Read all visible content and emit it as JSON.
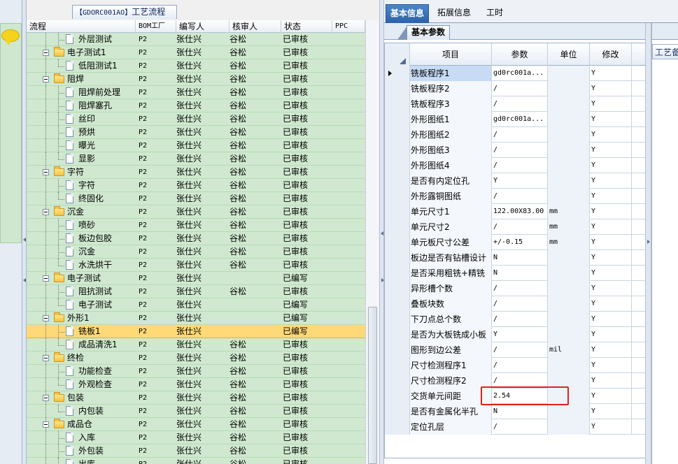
{
  "title_tab": {
    "code": "【GDORC001AO】",
    "label": "工艺流程"
  },
  "tree_grid": {
    "columns": [
      "流程",
      "BOM工厂",
      "编写人",
      "核审人",
      "状态",
      "PPC"
    ],
    "rows": [
      {
        "name": "外层测试",
        "bom": "P2",
        "writer": "张仕兴",
        "reviewer": "谷松",
        "status": "已审核",
        "level": 2,
        "folder": false,
        "last": false
      },
      {
        "name": "电子测试1",
        "bom": "P2",
        "writer": "张仕兴",
        "reviewer": "谷松",
        "status": "已审核",
        "level": 1,
        "folder": true,
        "last": false
      },
      {
        "name": "低阻测试1",
        "bom": "P2",
        "writer": "张仕兴",
        "reviewer": "谷松",
        "status": "已审核",
        "level": 2,
        "folder": false,
        "last": true
      },
      {
        "name": "阻焊",
        "bom": "P2",
        "writer": "张仕兴",
        "reviewer": "谷松",
        "status": "已审核",
        "level": 1,
        "folder": true,
        "last": false
      },
      {
        "name": "阻焊前处理",
        "bom": "P2",
        "writer": "张仕兴",
        "reviewer": "谷松",
        "status": "已审核",
        "level": 2,
        "folder": false,
        "last": false
      },
      {
        "name": "阻焊塞孔",
        "bom": "P2",
        "writer": "张仕兴",
        "reviewer": "谷松",
        "status": "已审核",
        "level": 2,
        "folder": false,
        "last": false
      },
      {
        "name": "丝印",
        "bom": "P2",
        "writer": "张仕兴",
        "reviewer": "谷松",
        "status": "已审核",
        "level": 2,
        "folder": false,
        "last": false
      },
      {
        "name": "预烘",
        "bom": "P2",
        "writer": "张仕兴",
        "reviewer": "谷松",
        "status": "已审核",
        "level": 2,
        "folder": false,
        "last": false
      },
      {
        "name": "曝光",
        "bom": "P2",
        "writer": "张仕兴",
        "reviewer": "谷松",
        "status": "已审核",
        "level": 2,
        "folder": false,
        "last": false
      },
      {
        "name": "显影",
        "bom": "P2",
        "writer": "张仕兴",
        "reviewer": "谷松",
        "status": "已审核",
        "level": 2,
        "folder": false,
        "last": true
      },
      {
        "name": "字符",
        "bom": "P2",
        "writer": "张仕兴",
        "reviewer": "谷松",
        "status": "已审核",
        "level": 1,
        "folder": true,
        "last": false
      },
      {
        "name": "字符",
        "bom": "P2",
        "writer": "张仕兴",
        "reviewer": "谷松",
        "status": "已审核",
        "level": 2,
        "folder": false,
        "last": false
      },
      {
        "name": "终固化",
        "bom": "P2",
        "writer": "张仕兴",
        "reviewer": "谷松",
        "status": "已审核",
        "level": 2,
        "folder": false,
        "last": true
      },
      {
        "name": "沉金",
        "bom": "P2",
        "writer": "张仕兴",
        "reviewer": "谷松",
        "status": "已审核",
        "level": 1,
        "folder": true,
        "last": false
      },
      {
        "name": "喷砂",
        "bom": "P2",
        "writer": "张仕兴",
        "reviewer": "谷松",
        "status": "已审核",
        "level": 2,
        "folder": false,
        "last": false
      },
      {
        "name": "板边包胶",
        "bom": "P2",
        "writer": "张仕兴",
        "reviewer": "谷松",
        "status": "已审核",
        "level": 2,
        "folder": false,
        "last": false
      },
      {
        "name": "沉金",
        "bom": "P2",
        "writer": "张仕兴",
        "reviewer": "谷松",
        "status": "已审核",
        "level": 2,
        "folder": false,
        "last": false
      },
      {
        "name": "水洗烘干",
        "bom": "P2",
        "writer": "张仕兴",
        "reviewer": "谷松",
        "status": "已审核",
        "level": 2,
        "folder": false,
        "last": true
      },
      {
        "name": "电子测试",
        "bom": "P2",
        "writer": "张仕兴",
        "reviewer": "",
        "status": "已编写",
        "level": 1,
        "folder": true,
        "last": false
      },
      {
        "name": "阻抗测试",
        "bom": "P2",
        "writer": "张仕兴",
        "reviewer": "谷松",
        "status": "已审核",
        "level": 2,
        "folder": false,
        "last": false
      },
      {
        "name": "电子测试",
        "bom": "P2",
        "writer": "张仕兴",
        "reviewer": "",
        "status": "已编写",
        "level": 2,
        "folder": false,
        "last": true
      },
      {
        "name": "外形1",
        "bom": "P2",
        "writer": "张仕兴",
        "reviewer": "",
        "status": "已编写",
        "level": 1,
        "folder": true,
        "last": false
      },
      {
        "name": "铣板1",
        "bom": "P2",
        "writer": "张仕兴",
        "reviewer": "",
        "status": "已编写",
        "level": 2,
        "folder": false,
        "last": false,
        "selected": true
      },
      {
        "name": "成品清洗1",
        "bom": "P2",
        "writer": "张仕兴",
        "reviewer": "谷松",
        "status": "已审核",
        "level": 2,
        "folder": false,
        "last": true
      },
      {
        "name": "终检",
        "bom": "P2",
        "writer": "张仕兴",
        "reviewer": "谷松",
        "status": "已审核",
        "level": 1,
        "folder": true,
        "last": false
      },
      {
        "name": "功能检查",
        "bom": "P2",
        "writer": "张仕兴",
        "reviewer": "谷松",
        "status": "已审核",
        "level": 2,
        "folder": false,
        "last": false
      },
      {
        "name": "外观检查",
        "bom": "P2",
        "writer": "张仕兴",
        "reviewer": "谷松",
        "status": "已审核",
        "level": 2,
        "folder": false,
        "last": true
      },
      {
        "name": "包装",
        "bom": "P2",
        "writer": "张仕兴",
        "reviewer": "谷松",
        "status": "已审核",
        "level": 1,
        "folder": true,
        "last": false
      },
      {
        "name": "内包装",
        "bom": "P2",
        "writer": "张仕兴",
        "reviewer": "谷松",
        "status": "已审核",
        "level": 2,
        "folder": false,
        "last": true
      },
      {
        "name": "成品仓",
        "bom": "P2",
        "writer": "张仕兴",
        "reviewer": "谷松",
        "status": "已审核",
        "level": 1,
        "folder": true,
        "last": false
      },
      {
        "name": "入库",
        "bom": "P2",
        "writer": "张仕兴",
        "reviewer": "谷松",
        "status": "已审核",
        "level": 2,
        "folder": false,
        "last": false
      },
      {
        "name": "外包装",
        "bom": "P2",
        "writer": "张仕兴",
        "reviewer": "谷松",
        "status": "已审核",
        "level": 2,
        "folder": false,
        "last": false
      },
      {
        "name": "出库",
        "bom": "P2",
        "writer": "张仕兴",
        "reviewer": "谷松",
        "status": "已审核",
        "level": 2,
        "folder": false,
        "last": true
      }
    ]
  },
  "right_tabs": [
    "基本信息",
    "拓展信息",
    "工时"
  ],
  "sub_tab": "基本参数",
  "props": {
    "columns": [
      "项目",
      "参数",
      "单位",
      "修改"
    ],
    "rows": [
      {
        "name": "铣板程序1",
        "value": "gd0rc001a...",
        "unit": "",
        "mod": "Y",
        "current": true
      },
      {
        "name": "铣板程序2",
        "value": "/",
        "unit": "",
        "mod": "Y"
      },
      {
        "name": "铣板程序3",
        "value": "/",
        "unit": "",
        "mod": "Y"
      },
      {
        "name": "外形图纸1",
        "value": "gd0rc001a...",
        "unit": "",
        "mod": "Y"
      },
      {
        "name": "外形图纸2",
        "value": "/",
        "unit": "",
        "mod": "Y"
      },
      {
        "name": "外形图纸3",
        "value": "/",
        "unit": "",
        "mod": "Y"
      },
      {
        "name": "外形图纸4",
        "value": "/",
        "unit": "",
        "mod": "Y"
      },
      {
        "name": "是否有内定位孔",
        "value": "Y",
        "unit": "",
        "mod": "Y"
      },
      {
        "name": "外形露铜图纸",
        "value": "/",
        "unit": "",
        "mod": "Y"
      },
      {
        "name": "单元尺寸1",
        "value": "122.00X83.00",
        "unit": "mm",
        "mod": "Y"
      },
      {
        "name": "单元尺寸2",
        "value": "/",
        "unit": "mm",
        "mod": "Y"
      },
      {
        "name": "单元板尺寸公差",
        "value": "+/-0.15",
        "unit": "mm",
        "mod": "Y"
      },
      {
        "name": "板边是否有钻槽设计",
        "value": "N",
        "unit": "",
        "mod": "Y"
      },
      {
        "name": "是否采用粗铣+精铣",
        "value": "N",
        "unit": "",
        "mod": "Y"
      },
      {
        "name": "异形槽个数",
        "value": "/",
        "unit": "",
        "mod": "Y"
      },
      {
        "name": "叠板块数",
        "value": "/",
        "unit": "",
        "mod": "Y"
      },
      {
        "name": "下刀点总个数",
        "value": "/",
        "unit": "",
        "mod": "Y"
      },
      {
        "name": "是否为大板铣成小板",
        "value": "Y",
        "unit": "",
        "mod": "Y"
      },
      {
        "name": "图形到边公差",
        "value": "/",
        "unit": "mil",
        "mod": "Y"
      },
      {
        "name": "尺寸检测程序1",
        "value": "/",
        "unit": "",
        "mod": "Y"
      },
      {
        "name": "尺寸检测程序2",
        "value": "/",
        "unit": "",
        "mod": "Y"
      },
      {
        "name": "交货单元间距",
        "value": "2.54",
        "unit": "",
        "mod": "Y",
        "highlight": true
      },
      {
        "name": "是否有金属化半孔",
        "value": "N",
        "unit": "",
        "mod": "Y"
      },
      {
        "name": "定位孔层",
        "value": "/",
        "unit": "",
        "mod": "Y"
      }
    ]
  },
  "far_right_tab": "工艺备注"
}
